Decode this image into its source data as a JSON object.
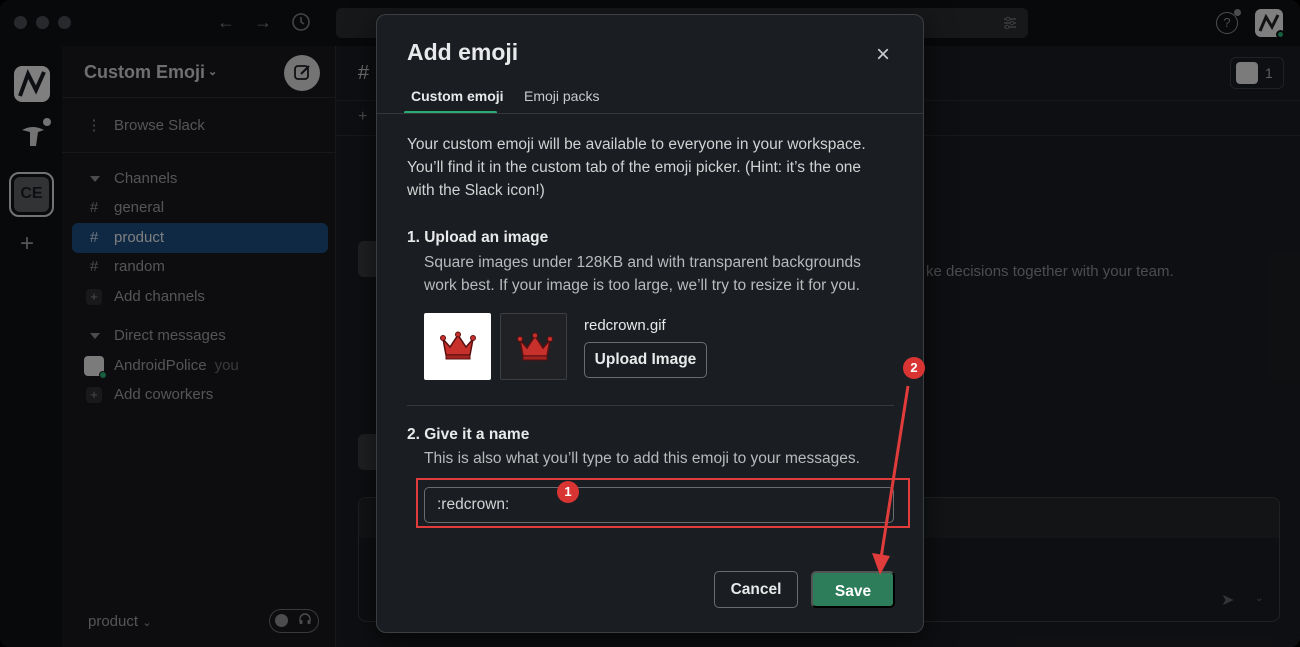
{
  "sidebar": {
    "workspace_name": "Custom Emoji",
    "browse": "Browse Slack",
    "channels_header": "Channels",
    "channels": [
      "general",
      "product",
      "random"
    ],
    "add_channels": "Add channels",
    "dm_header": "Direct messages",
    "dm_user": "AndroidPolice",
    "dm_you": "you",
    "add_coworkers": "Add coworkers",
    "footer_channel": "product"
  },
  "rail": {
    "workspace_initials": "CE"
  },
  "main": {
    "header_hash": "#",
    "member_count": "1",
    "background_text": "ke decisions together with your team."
  },
  "modal": {
    "title": "Add emoji",
    "tabs": [
      "Custom emoji",
      "Emoji packs"
    ],
    "intro": "Your custom emoji will be available to everyone in your workspace. You’ll find it in the custom tab of the emoji picker. (Hint: it’s the one with the Slack icon!)",
    "step1_title": "1. Upload an image",
    "step1_desc": "Square images under 128KB and with transparent backgrounds work best. If your image is too large, we’ll try to resize it for you.",
    "filename": "redcrown.gif",
    "upload_label": "Upload Image",
    "step2_title": "2. Give it a name",
    "step2_desc": "This is also what you’ll type to add this emoji to your messages.",
    "name_value": ":redcrown:",
    "cancel_label": "Cancel",
    "save_label": "Save"
  },
  "annotations": {
    "badge1": "1",
    "badge2": "2",
    "color": "#e03c3c"
  },
  "colors": {
    "accent_green": "#2d7d5a",
    "active_channel": "#1d4a7a",
    "tab_underline": "#2bac76"
  }
}
